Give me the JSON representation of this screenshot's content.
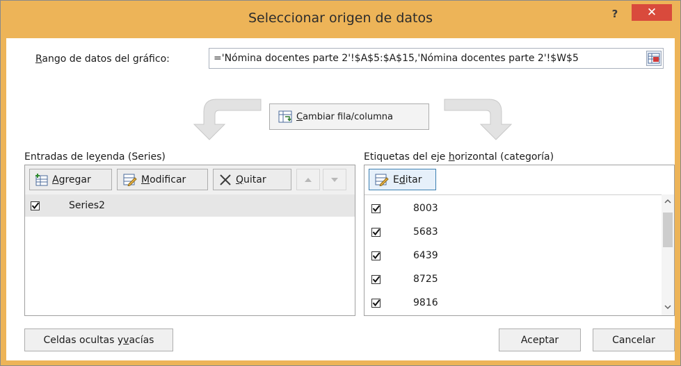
{
  "window": {
    "title": "Seleccionar origen de datos",
    "help_glyph": "?",
    "close_glyph": "✕"
  },
  "range": {
    "label_pre": "",
    "label_underlined": "R",
    "label_post": "ango de datos del gráfico:",
    "value": "='Nómina  docentes parte 2'!$A$5:$A$15,'Nómina  docentes parte 2'!$W$5"
  },
  "switch_button": {
    "underlined": "C",
    "rest": "ambiar fila/columna"
  },
  "legend_section": {
    "label_pre": "Entradas de le",
    "label_underlined": "y",
    "label_post": "enda (Series)",
    "buttons": {
      "add": {
        "underlined": "A",
        "rest": "gregar"
      },
      "edit": {
        "underlined": "M",
        "rest": "odificar"
      },
      "remove": {
        "underlined": "Q",
        "rest": "uitar"
      }
    },
    "series": [
      {
        "name": "Series2",
        "checked": true
      }
    ]
  },
  "axis_section": {
    "label_pre": "Etiquetas del eje ",
    "label_underlined": "h",
    "label_post": "orizontal (categoría)",
    "edit_button": {
      "pre": "E",
      "underlined": "d",
      "rest": "itar"
    },
    "categories": [
      {
        "value": "8003",
        "checked": true
      },
      {
        "value": "5683",
        "checked": true
      },
      {
        "value": "6439",
        "checked": true
      },
      {
        "value": "8725",
        "checked": true
      },
      {
        "value": "9816",
        "checked": true
      }
    ]
  },
  "footer": {
    "hidden_cells": {
      "pre": "Celdas ocultas y ",
      "underlined": "v",
      "post": "acías"
    },
    "ok": "Aceptar",
    "cancel": "Cancelar"
  },
  "colors": {
    "title_bar": "#edb458",
    "close_button": "#d94a3c",
    "selected_row": "#e6e6e6"
  }
}
